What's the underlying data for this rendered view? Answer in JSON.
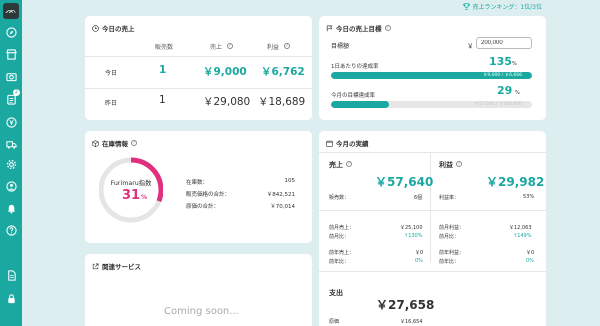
{
  "colors": {
    "accent": "#1aa8a0",
    "pink": "#e02f7d",
    "background": "#dceef0"
  },
  "sidebar": {
    "logo": "ᨏ",
    "items": [
      {
        "icon": "compass-icon"
      },
      {
        "icon": "store-icon"
      },
      {
        "icon": "camera-icon"
      },
      {
        "icon": "clipboard-icon",
        "badge": "2"
      },
      {
        "icon": "yen-coin-icon"
      },
      {
        "icon": "truck-icon"
      },
      {
        "icon": "gear-icon"
      },
      {
        "icon": "user-icon"
      },
      {
        "icon": "bell-icon"
      },
      {
        "icon": "help-icon"
      },
      {
        "icon": "document-icon"
      },
      {
        "icon": "lock-icon"
      }
    ]
  },
  "topbar": {
    "ranking": "売上ランキング：1位/3位",
    "icon": "trophy-icon"
  },
  "today_sales": {
    "title": "今日の売上",
    "headers": [
      "販売数",
      "売上",
      "利益"
    ],
    "rows": [
      {
        "label": "今日",
        "count": "1",
        "sales": "￥9,000",
        "profit": "￥6,762"
      },
      {
        "label": "昨日",
        "count": "1",
        "sales": "￥29,080",
        "profit": "￥18,689"
      }
    ]
  },
  "target": {
    "title": "今日の売上目標",
    "amount_label": "目標額",
    "currency": "￥",
    "amount_value": "200,000",
    "daily_label": "1日あたりの達成率",
    "daily_percent": "135",
    "daily_bar_text": "￥9,000 / ￥6,666",
    "daily_progress": 1.0,
    "month_label": "今月の目標達成率",
    "month_percent": "29",
    "month_bar_text": "￥57,640 / ￥200,000",
    "month_progress": 0.29,
    "percent_unit": "%"
  },
  "inventory": {
    "title": "在庫情報",
    "gauge_label": "Furimaru指数",
    "gauge_value": "31",
    "gauge_unit": "%",
    "gauge_fraction": 0.31,
    "rows": [
      {
        "label": "在庫数：",
        "value": "105"
      },
      {
        "label": "販売価格の合計：",
        "value": "￥842,521"
      },
      {
        "label": "原価の合計：",
        "value": "￥70,014"
      }
    ]
  },
  "related": {
    "title": "関連サービス",
    "coming_soon": "Coming soon..."
  },
  "monthly": {
    "title": "今月の実績",
    "sales": {
      "label": "売上",
      "value": "￥57,640",
      "count_label": "販売数：",
      "count_value": "6個",
      "prev_label": "前月売上：",
      "prev_value": "￥25,100",
      "ratio_label": "前月比：",
      "ratio_value": "↑130%",
      "prev_year_label": "前年売上：",
      "prev_year_value": "￥0",
      "year_ratio_label": "前年比：",
      "year_ratio_value": "0%"
    },
    "profit": {
      "label": "利益",
      "value": "￥29,982",
      "rate_label": "利益率：",
      "rate_value": "53%",
      "prev_label": "前月利益：",
      "prev_value": "￥12,063",
      "ratio_label": "前月比：",
      "ratio_value": "↑149%",
      "prev_year_label": "前年利益：",
      "prev_year_value": "￥0",
      "year_ratio_label": "前年比：",
      "year_ratio_value": "0%"
    },
    "expense": {
      "label": "支出",
      "value": "￥27,658",
      "row_label": "原価",
      "row_value": "￥16,654"
    }
  }
}
